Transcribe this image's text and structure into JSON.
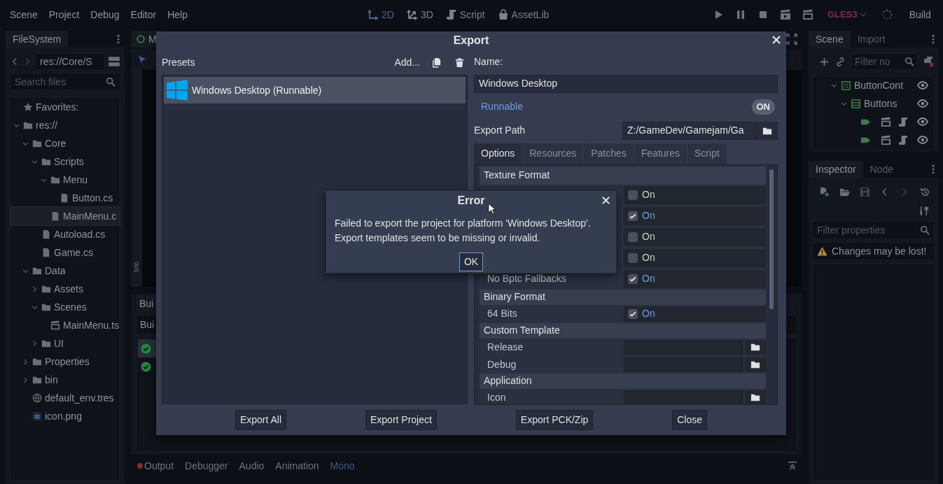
{
  "menu": [
    "Scene",
    "Project",
    "Debug",
    "Editor",
    "Help"
  ],
  "workspaces": [
    {
      "label": "2D",
      "kind": "planar",
      "selected": true
    },
    {
      "label": "3D",
      "kind": "spatial",
      "selected": false
    },
    {
      "label": "Script",
      "kind": "script",
      "selected": false
    },
    {
      "label": "AssetLib",
      "kind": "assetlib",
      "selected": false
    }
  ],
  "renderer": "GLES3",
  "build_button": "Build",
  "filesystem": {
    "tab": "FileSystem",
    "path": "res://Core/S",
    "search_placeholder": "Search files",
    "favorites": "Favorites:",
    "tree": [
      {
        "label": "res://",
        "kind": "folder",
        "expanded": true,
        "selected": false,
        "children": [
          {
            "label": "Core",
            "kind": "folder",
            "expanded": true,
            "selected": false,
            "children": [
              {
                "label": "Scripts",
                "kind": "folder",
                "expanded": true,
                "selected": false,
                "children": [
                  {
                    "label": "Menu",
                    "kind": "folder",
                    "expanded": true,
                    "selected": false,
                    "children": [
                      {
                        "label": "Button.cs",
                        "kind": "file",
                        "selected": false
                      }
                    ]
                  },
                  {
                    "label": "MainMenu.c",
                    "kind": "file",
                    "selected": true
                  }
                ]
              },
              {
                "label": "Autoload.cs",
                "kind": "file",
                "selected": false
              },
              {
                "label": "Game.cs",
                "kind": "file",
                "selected": false
              }
            ]
          },
          {
            "label": "Data",
            "kind": "folder",
            "expanded": true,
            "selected": false,
            "children": [
              {
                "label": "Assets",
                "kind": "folder",
                "expanded": false,
                "selected": false
              },
              {
                "label": "Scenes",
                "kind": "folder",
                "expanded": true,
                "selected": false,
                "children": [
                  {
                    "label": "MainMenu.ts",
                    "kind": "scene",
                    "selected": false
                  }
                ]
              },
              {
                "label": "UI",
                "kind": "folder",
                "expanded": false,
                "selected": false
              }
            ]
          },
          {
            "label": "Properties",
            "kind": "folder",
            "expanded": false,
            "selected": false
          },
          {
            "label": "bin",
            "kind": "folder",
            "expanded": false,
            "selected": false
          },
          {
            "label": "default_env.tres",
            "kind": "environment",
            "selected": false
          },
          {
            "label": "icon.png",
            "kind": "image",
            "selected": false
          }
        ]
      }
    ]
  },
  "scene_tab": "M",
  "ruler_label": "500",
  "bottom_panel": {
    "tab": "Bui",
    "field": "Bui",
    "rows": [
      {
        "kind": "success",
        "selected": true
      },
      {
        "kind": "success",
        "selected": false
      }
    ]
  },
  "bottom_tabs": [
    {
      "label": "Output",
      "alert": true,
      "selected": false
    },
    {
      "label": "Debugger",
      "alert": false,
      "selected": false
    },
    {
      "label": "Audio",
      "alert": false,
      "selected": false
    },
    {
      "label": "Animation",
      "alert": false,
      "selected": false
    },
    {
      "label": "Mono",
      "alert": false,
      "selected": true
    }
  ],
  "scene_dock": {
    "tabs": [
      {
        "label": "Scene",
        "selected": true
      },
      {
        "label": "Import",
        "selected": false
      }
    ],
    "filter_placeholder": "Filter no",
    "tree": [
      {
        "label": "ButtonCont",
        "kind": "container",
        "expanded": true,
        "visible": true,
        "children": [
          {
            "label": "Buttons",
            "kind": "vbox",
            "expanded": true,
            "visible": true,
            "children": [
              {
                "kind": "label",
                "instanced": true,
                "scripted": true,
                "visible": true
              },
              {
                "kind": "label",
                "instanced": true,
                "scripted": true,
                "visible": true
              }
            ]
          }
        ]
      }
    ]
  },
  "inspector": {
    "tabs": [
      {
        "label": "Inspector",
        "selected": true
      },
      {
        "label": "Node",
        "selected": false
      }
    ],
    "filter_placeholder": "Filter properties",
    "warning": "Changes may be lost!"
  },
  "export_dialog": {
    "title": "Export",
    "presets_label": "Presets",
    "add_button": "Add...",
    "presets": [
      {
        "label": "Windows Desktop (Runnable)",
        "kind": "windows",
        "selected": true
      }
    ],
    "name_label": "Name:",
    "name_value": "Windows Desktop",
    "runnable": {
      "label": "Runnable",
      "on": true,
      "switch_text": "ON"
    },
    "export_path_label": "Export Path",
    "export_path": "Z:/GameDev/Gamejam/Ga",
    "tabs": [
      {
        "label": "Options",
        "selected": true
      },
      {
        "label": "Resources",
        "selected": false
      },
      {
        "label": "Patches",
        "selected": false
      },
      {
        "label": "Features",
        "selected": false
      },
      {
        "label": "Script",
        "selected": false
      }
    ],
    "sections": [
      {
        "title": "Texture Format",
        "properties": [
          {
            "kind": "check",
            "checked": false,
            "value": "On"
          },
          {
            "kind": "check",
            "checked": true,
            "value": "On"
          },
          {
            "kind": "check",
            "checked": false,
            "value": "On"
          },
          {
            "kind": "check",
            "checked": false,
            "value": "On"
          },
          {
            "label": "No Bptc Fallbacks",
            "kind": "check",
            "checked": true,
            "value": "On"
          }
        ]
      },
      {
        "title": "Binary Format",
        "properties": [
          {
            "label": "64 Bits",
            "kind": "check",
            "checked": true,
            "value": "On"
          }
        ]
      },
      {
        "title": "Custom Template",
        "properties": [
          {
            "label": "Release",
            "kind": "file"
          },
          {
            "label": "Debug",
            "kind": "file"
          }
        ]
      },
      {
        "title": "Application",
        "properties": [
          {
            "label": "Icon",
            "kind": "file"
          }
        ]
      }
    ],
    "buttons": [
      "Export All",
      "Export Project",
      "Export PCK/Zip",
      "Close"
    ]
  },
  "error_dialog": {
    "title": "Error",
    "message": "Failed to export the project for platform 'Windows Desktop'.\nExport templates seem to be missing or invalid.",
    "ok_button": "OK"
  }
}
